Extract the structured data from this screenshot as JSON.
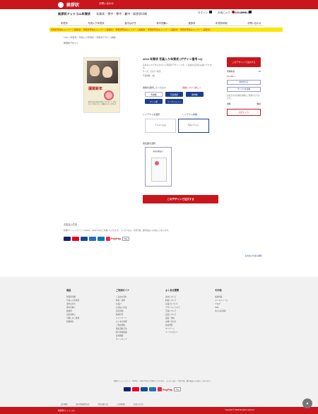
{
  "header": {
    "logo": "挨拶状",
    "top_link": "お問い合わせ",
    "brand": "挨拶状ドットコム年賀状",
    "brand_sub": "年賀状・喪中・寒中・暑中・挨拶状印刷",
    "icons": [
      "ログイン",
      "お気に入り",
      "カート"
    ],
    "phone": "0120-0000-00"
  },
  "nav": [
    "年賀状",
    "写真入り年賀状",
    "喪中はがき",
    "寒中見舞い",
    "挨拶状",
    "年賀状印刷",
    "お問い合わせ"
  ],
  "banner": "年賀状早割キャンペーン実施中！ 年賀状早割キャンペーン実施中！ 年賀状早割キャンペーン実施中！ 年賀状早割キャンペーン実施中！ 年賀状早割キャンペーン実施中！",
  "breadcrumb": "TOP > 年賀状 > 写真入り年賀状 > 年賀状デザイン詳細",
  "page_head": "年賀状デザイン",
  "product": {
    "title": "2024 年賀状 写真入り年賀状 (デザイン番号 12)",
    "desc": "写真を入れて作るかわいい年賀状デザインです。ご家族の近況をお届けできます。",
    "spec1": "サイズ：はがき / 縦型",
    "spec2": "写真枚数：1枚"
  },
  "thumb": {
    "greeting": "謹賀新年",
    "note": "旧年中は大変お世話になりました 本年もどうぞよろしくお願い申し上げます"
  },
  "options": {
    "label1": "用紙を選択してください",
    "right1": "用紙について詳しく",
    "buttons": [
      "普通紙",
      "写真用紙",
      "無地紙",
      "マット紙",
      "インクジェット"
    ],
    "label2": "レイアウトを選択",
    "right2": "レイアウト詳細",
    "choice1": "テキストのみ",
    "choice2": "写真+テキスト",
    "label3": "宛名面を選択",
    "card_text": "宛名印刷あり"
  },
  "cta": "このデザインで注文する",
  "side": {
    "order_button": "このデザインで注文する",
    "row1_label": "印刷料金",
    "row1_value": "¥0",
    "price": "¥1,650〜",
    "btn1": "料金を見る",
    "btn2": "サンプルを請求",
    "desc": "お急ぎの方は特急印刷もご利用いただけます。",
    "row2_label": "送料",
    "row2_value": "無料",
    "favorite": "お気に入り"
  },
  "payment": {
    "heading": "お支払い方法",
    "text": "各種クレジットカード、PayPay、Apple Payがご利用いただけます。 コンビニ払い、代金引換、銀行振込にも対応しております。",
    "link": "お支払い方法の詳細",
    "paypay": "PayPay",
    "pay_label": "Pay"
  },
  "footer": {
    "cols": [
      {
        "h": "商品",
        "items": [
          "年賀状印刷",
          "写真入り年賀状",
          "喪中はがき",
          "寒中見舞い",
          "挨拶状",
          "出産内祝い",
          "引越しのご挨拶",
          "結婚報告"
        ]
      },
      {
        "h": "ご利用ガイド",
        "items": [
          "ご注文の流れ",
          "料金・送料",
          "お届け",
          "お支払い方法",
          "宛名印刷",
          "投函代行",
          "キャンペーン",
          "よくある質問",
          "ご利用規約",
          "特定商取引法",
          "個人情報保護",
          "会社概要",
          "サイトマップ"
        ]
      },
      {
        "h": "よくある質問",
        "items": [
          "注文について",
          "料金について",
          "お届けについて",
          "デザインについて",
          "写真について",
          "宛名について",
          "返品・交換",
          "お問い合わせ",
          "会員登録",
          "マイページ",
          "メールマガジン"
        ]
      },
      {
        "h": "その他",
        "items": [
          "採用情報",
          "プレスリリース",
          "ブログ",
          "SNS",
          "法人のお客様"
        ]
      }
    ],
    "note": "各種クレジットカード、PayPay、Apple Payがご利用いただけます。 コンビニ払い、代金引換、銀行振込にも対応しております。",
    "bottom": [
      "会社概要",
      "個人情報保護方針",
      "特定商取引法",
      "ご利用規約",
      "お問い合わせ"
    ],
    "bar_left": "挨拶状ドットコム",
    "bar_right": "Copyright © 2023 All rights reserved."
  },
  "colors": {
    "brand": "#c8161d",
    "accent": "#1c3f8f",
    "banner": "#f7e700"
  }
}
